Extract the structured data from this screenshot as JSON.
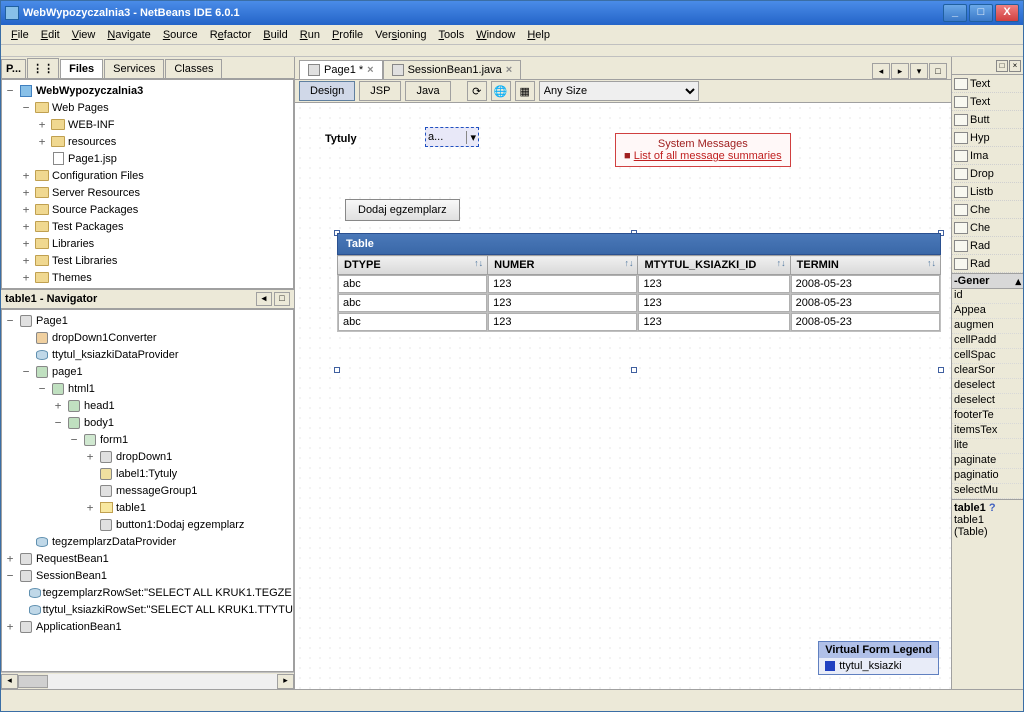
{
  "window": {
    "title": "WebWypozyczalnia3 - NetBeans IDE 6.0.1"
  },
  "menubar": [
    "File",
    "Edit",
    "View",
    "Navigate",
    "Source",
    "Refactor",
    "Build",
    "Run",
    "Profile",
    "Versioning",
    "Tools",
    "Window",
    "Help"
  ],
  "left_tabs": {
    "p": "P...",
    "files": "Files",
    "services": "Services",
    "classes": "Classes"
  },
  "project_tree": {
    "root": "WebWypozyczalnia3",
    "n1": "Web Pages",
    "n1a": "WEB-INF",
    "n1b": "resources",
    "n1c": "Page1.jsp",
    "n2": "Configuration Files",
    "n3": "Server Resources",
    "n4": "Source Packages",
    "n5": "Test Packages",
    "n6": "Libraries",
    "n7": "Test Libraries",
    "n8": "Themes"
  },
  "navigator": {
    "title": "table1 - Navigator",
    "root": "Page1",
    "a": "dropDown1Converter",
    "b": "ttytul_ksiazkiDataProvider",
    "c": "page1",
    "c1": "html1",
    "c1a": "head1",
    "c1b": "body1",
    "c1b1": "form1",
    "c1b1a": "dropDown1",
    "c1b1b": "label1:Tytuly",
    "c1b1c": "messageGroup1",
    "c1b1d": "table1",
    "c1b1e": "button1:Dodaj egzemplarz",
    "d": "tegzemplarzDataProvider",
    "e": "RequestBean1",
    "f": "SessionBean1",
    "f1": "tegzemplarzRowSet:\"SELECT ALL KRUK1.TEGZE",
    "f2": "ttytul_ksiazkiRowSet:\"SELECT ALL KRUK1.TTYTU",
    "g": "ApplicationBean1"
  },
  "editor_tabs": {
    "t1": "Page1 *",
    "t2": "SessionBean1.java"
  },
  "subbar": {
    "design": "Design",
    "jsp": "JSP",
    "java": "Java",
    "size": "Any Size"
  },
  "designer": {
    "label": "Tytuly",
    "dropdown": "a...",
    "msg_title": "System Messages",
    "msg_link": "List of all message summaries",
    "button": "Dodaj egzemplarz",
    "table_title": "Table",
    "cols": [
      "DTYPE",
      "NUMER",
      "MTYTUL_KSIAZKI_ID",
      "TERMIN"
    ],
    "rows": [
      [
        "abc",
        "123",
        "123",
        "2008-05-23"
      ],
      [
        "abc",
        "123",
        "123",
        "2008-05-23"
      ],
      [
        "abc",
        "123",
        "123",
        "2008-05-23"
      ]
    ],
    "vfl_title": "Virtual Form Legend",
    "vfl_item": "ttytul_ksiazki"
  },
  "palette": [
    "Text",
    "Text",
    "Butt",
    "Hyp",
    "Ima",
    "Drop",
    "Listb",
    "Che",
    "Che",
    "Rad",
    "Rad"
  ],
  "props_header": "Gener",
  "props": [
    "id",
    "Appea",
    "augmen",
    "cellPadd",
    "cellSpac",
    "clearSor",
    "deselect",
    "deselect",
    "footerTe",
    "itemsTex",
    "lite",
    "paginate",
    "paginatio",
    "selectMu"
  ],
  "props_footer": {
    "name": "table1",
    "val": "table1",
    "type": "(Table)"
  }
}
